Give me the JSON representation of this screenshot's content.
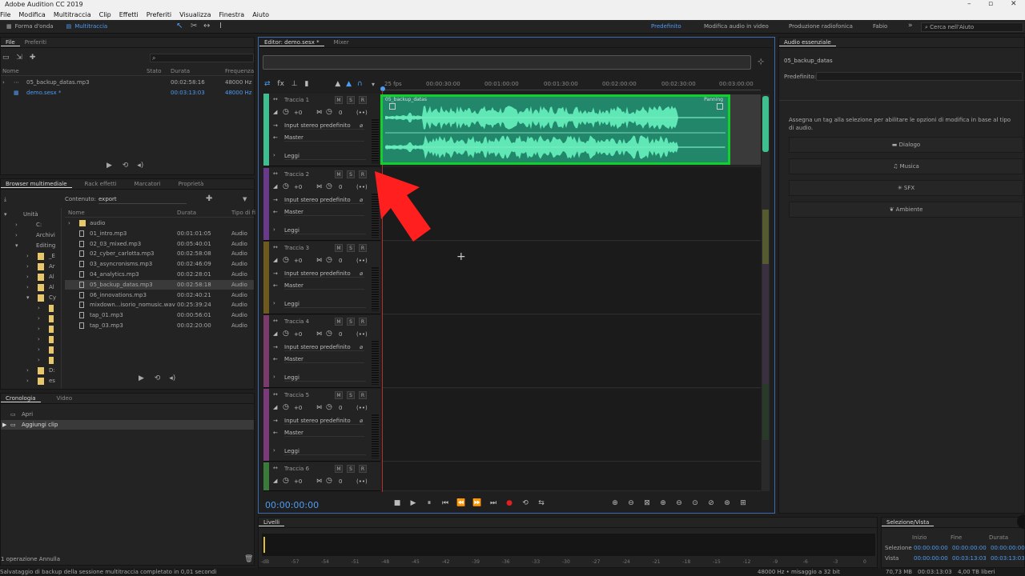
{
  "window": {
    "title": "Adobe Audition CC 2019"
  },
  "menu": [
    "File",
    "Modifica",
    "Multitraccia",
    "Clip",
    "Effetti",
    "Preferiti",
    "Visualizza",
    "Finestra",
    "Aiuto"
  ],
  "modes": {
    "waveform": "Forma d'onda",
    "multitrack": "Multitraccia"
  },
  "workspaces": {
    "items": [
      "Predefinito",
      "Modifica audio in video",
      "Produzione radiofonica",
      "Fabio"
    ],
    "search_placeholder": "Cerca nell'Aiuto"
  },
  "files_panel": {
    "tabs": [
      "File",
      "Preferiti"
    ],
    "columns": [
      "Nome",
      "Stato",
      "Durata",
      "Frequenza"
    ],
    "rows": [
      {
        "name": "05_backup_datas.mp3",
        "duration": "00:02:58:16",
        "freq": "48000 Hz"
      },
      {
        "name": "demo.sesx *",
        "duration": "00:03:13:03",
        "freq": "48000 Hz"
      }
    ]
  },
  "media_browser": {
    "tabs": [
      "Browser multimediale",
      "Rack effetti",
      "Marcatori",
      "Proprietà"
    ],
    "content_label": "Contenuto:",
    "content_value": "export",
    "tree": [
      "Unità",
      "C:",
      "Archivi",
      "Editing",
      "_E",
      "Ar",
      "Al",
      "Al",
      "Cy",
      "D:",
      "es"
    ],
    "columns": [
      "Nome",
      "Durata",
      "Tipo di fi"
    ],
    "rows": [
      {
        "name": "audio",
        "duration": "",
        "type": ""
      },
      {
        "name": "01_intro.mp3",
        "duration": "00:01:01:05",
        "type": "Audio"
      },
      {
        "name": "02_03_mixed.mp3",
        "duration": "00:05:40:01",
        "type": "Audio"
      },
      {
        "name": "02_cyber_carlotta.mp3",
        "duration": "00:02:58:08",
        "type": "Audio"
      },
      {
        "name": "03_asyncronisms.mp3",
        "duration": "00:02:46:09",
        "type": "Audio"
      },
      {
        "name": "04_analytics.mp3",
        "duration": "00:02:28:01",
        "type": "Audio"
      },
      {
        "name": "05_backup_datas.mp3",
        "duration": "00:02:58:18",
        "type": "Audio"
      },
      {
        "name": "06_innovations.mp3",
        "duration": "00:02:40:21",
        "type": "Audio"
      },
      {
        "name": "mixdown...isorio_nomusic.wav",
        "duration": "00:25:39:24",
        "type": "Audio"
      },
      {
        "name": "tap_01.mp3",
        "duration": "00:00:56:01",
        "type": "Audio"
      },
      {
        "name": "tap_03.mp3",
        "duration": "00:02:20:00",
        "type": "Audio"
      }
    ]
  },
  "history": {
    "tabs": [
      "Cronologia",
      "Video"
    ],
    "items": [
      "Apri",
      "Aggiungi clip"
    ],
    "footer": "1 operazione Annulla"
  },
  "editor": {
    "tabs": [
      "Editor: demo.sesx *",
      "Mixer"
    ],
    "fps": "25 fps",
    "ruler": [
      "00:00:30:00",
      "00:01:00:00",
      "00:01:30:00",
      "00:02:00:00",
      "00:02:30:00",
      "00:03:00:00"
    ],
    "timecode": "00:00:00:00",
    "clip": {
      "name": "05_backup_datas",
      "label": "Panning"
    },
    "tracks": [
      {
        "name": "Traccia 1",
        "color": "#3fbf8f",
        "vol": "+0",
        "pan": "0",
        "input": "Input stereo predefinito",
        "output": "Master",
        "mode": "Leggi"
      },
      {
        "name": "Traccia 2",
        "color": "#6a3a8a",
        "vol": "+0",
        "pan": "0",
        "input": "Input stereo predefinito",
        "output": "Master",
        "mode": "Leggi"
      },
      {
        "name": "Traccia 3",
        "color": "#6e5a1e",
        "vol": "+0",
        "pan": "0",
        "input": "Input stereo predefinito",
        "output": "Master",
        "mode": "Leggi"
      },
      {
        "name": "Traccia 4",
        "color": "#7a3a6a",
        "vol": "+0",
        "pan": "0",
        "input": "Input stereo predefinito",
        "output": "Master",
        "mode": "Leggi"
      },
      {
        "name": "Traccia 5",
        "color": "#7a3a7a",
        "vol": "+0",
        "pan": "0",
        "input": "Input stereo predefinito",
        "output": "Master",
        "mode": "Leggi"
      },
      {
        "name": "Traccia 6",
        "color": "#3a7a3a",
        "vol": "+0",
        "pan": "0",
        "input": "",
        "output": "",
        "mode": ""
      }
    ],
    "msr": [
      "M",
      "S",
      "R"
    ]
  },
  "essential": {
    "title": "Audio essenziale",
    "clip_name": "05_backup_datas",
    "preset_label": "Predefinito:",
    "help": "Assegna un tag alla selezione per abilitare le opzioni di modifica in base al tipo di audio.",
    "buttons": [
      "Dialogo",
      "Musica",
      "SFX",
      "Ambiente"
    ]
  },
  "levels": {
    "title": "Livelli",
    "ticks": [
      "-dB",
      "-57",
      "-54",
      "-51",
      "-48",
      "-45",
      "-42",
      "-39",
      "-36",
      "-33",
      "-30",
      "-27",
      "-24",
      "-21",
      "-18",
      "-15",
      "-12",
      "-9",
      "-6",
      "-3",
      "0"
    ]
  },
  "selection": {
    "title": "Selezione/Vista",
    "columns": [
      "Inizio",
      "Fine",
      "Durata"
    ],
    "rows": [
      {
        "label": "Selezione",
        "start": "00:00:00:00",
        "end": "00:00:00:00",
        "dur": "00:00:00:00"
      },
      {
        "label": "Vista",
        "start": "00:00:00:00",
        "end": "00:03:13:03",
        "dur": "00:03:13:03"
      }
    ]
  },
  "status": {
    "left": "Salvataggio di backup della sessione multitraccia completato in 0,01 secondi",
    "format": "48000 Hz • misaggio a 32 bit",
    "mem": "70,73 MB",
    "dur": "00:03:13:03",
    "disk": "4,00 TB liberi"
  }
}
